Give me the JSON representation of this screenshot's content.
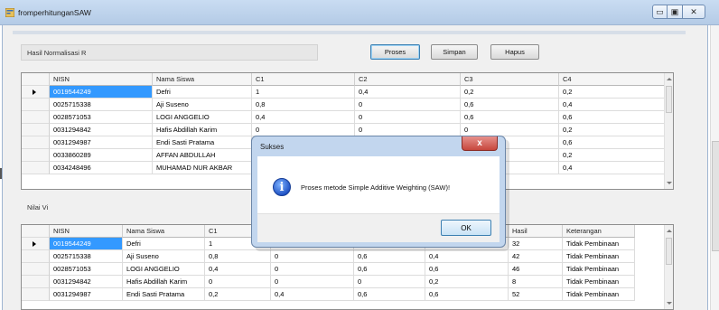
{
  "window": {
    "title": "fromperhitunganSAW",
    "minimize": "▭",
    "maximize": "▣",
    "close": "✕"
  },
  "toolbar": {
    "proses_label": "Proses",
    "simpan_label": "Simpan",
    "hapus_label": "Hapus"
  },
  "normalisasi": {
    "label": "Hasil Normalisasi R",
    "columns": [
      "NISN",
      "Nama Siswa",
      "C1",
      "C2",
      "C3",
      "C4"
    ],
    "rows": [
      [
        "0019544249",
        "Defri",
        "1",
        "0,4",
        "0,2",
        "0,2"
      ],
      [
        "0025715338",
        "Aji Suseno",
        "0,8",
        "0",
        "0,6",
        "0,4"
      ],
      [
        "0028571053",
        "LOGI ANGGELIO",
        "0,4",
        "0",
        "0,6",
        "0,6"
      ],
      [
        "0031294842",
        "Hafis Abdillah Karim",
        "0",
        "0",
        "0",
        "0,2"
      ],
      [
        "0031294987",
        "Endi Sasti Pratama",
        "",
        "",
        "",
        "0,6"
      ],
      [
        "0033860289",
        "AFFAN ABDULLAH",
        "",
        "",
        "",
        "0,2"
      ],
      [
        "0034248496",
        "MUHAMAD NUR AKBAR",
        "",
        "",
        "",
        "0,4"
      ]
    ]
  },
  "nilai_vi": {
    "label": "Nilai Vi",
    "columns": [
      "NISN",
      "Nama Siswa",
      "C1",
      "",
      "",
      "",
      "Hasil",
      "Keterangan"
    ],
    "rows": [
      [
        "0019544249",
        "Defri",
        "1",
        "",
        "",
        "",
        "32",
        "Tidak Pembinaan"
      ],
      [
        "0025715338",
        "Aji Suseno",
        "0,8",
        "0",
        "0,6",
        "0,4",
        "42",
        "Tidak Pembinaan"
      ],
      [
        "0028571053",
        "LOGI ANGGELIO",
        "0,4",
        "0",
        "0,6",
        "0,6",
        "46",
        "Tidak Pembinaan"
      ],
      [
        "0031294842",
        "Hafis Abdillah Karim",
        "0",
        "0",
        "0",
        "0,2",
        "8",
        "Tidak Pembinaan"
      ],
      [
        "0031294987",
        "Endi Sasti Pratama",
        "0,2",
        "0,4",
        "0,6",
        "0,6",
        "52",
        "Tidak Pembinaan"
      ]
    ]
  },
  "dialog": {
    "title": "Sukses",
    "message": "Proses metode Simple Additive Weighting (SAW)!",
    "ok_label": "OK",
    "close_glyph": "x",
    "icon_glyph": "i"
  },
  "colors": {
    "selection": "#3399ff",
    "titlebar": "#c9dcf2",
    "dialog_frame": "#c2d6ee"
  }
}
